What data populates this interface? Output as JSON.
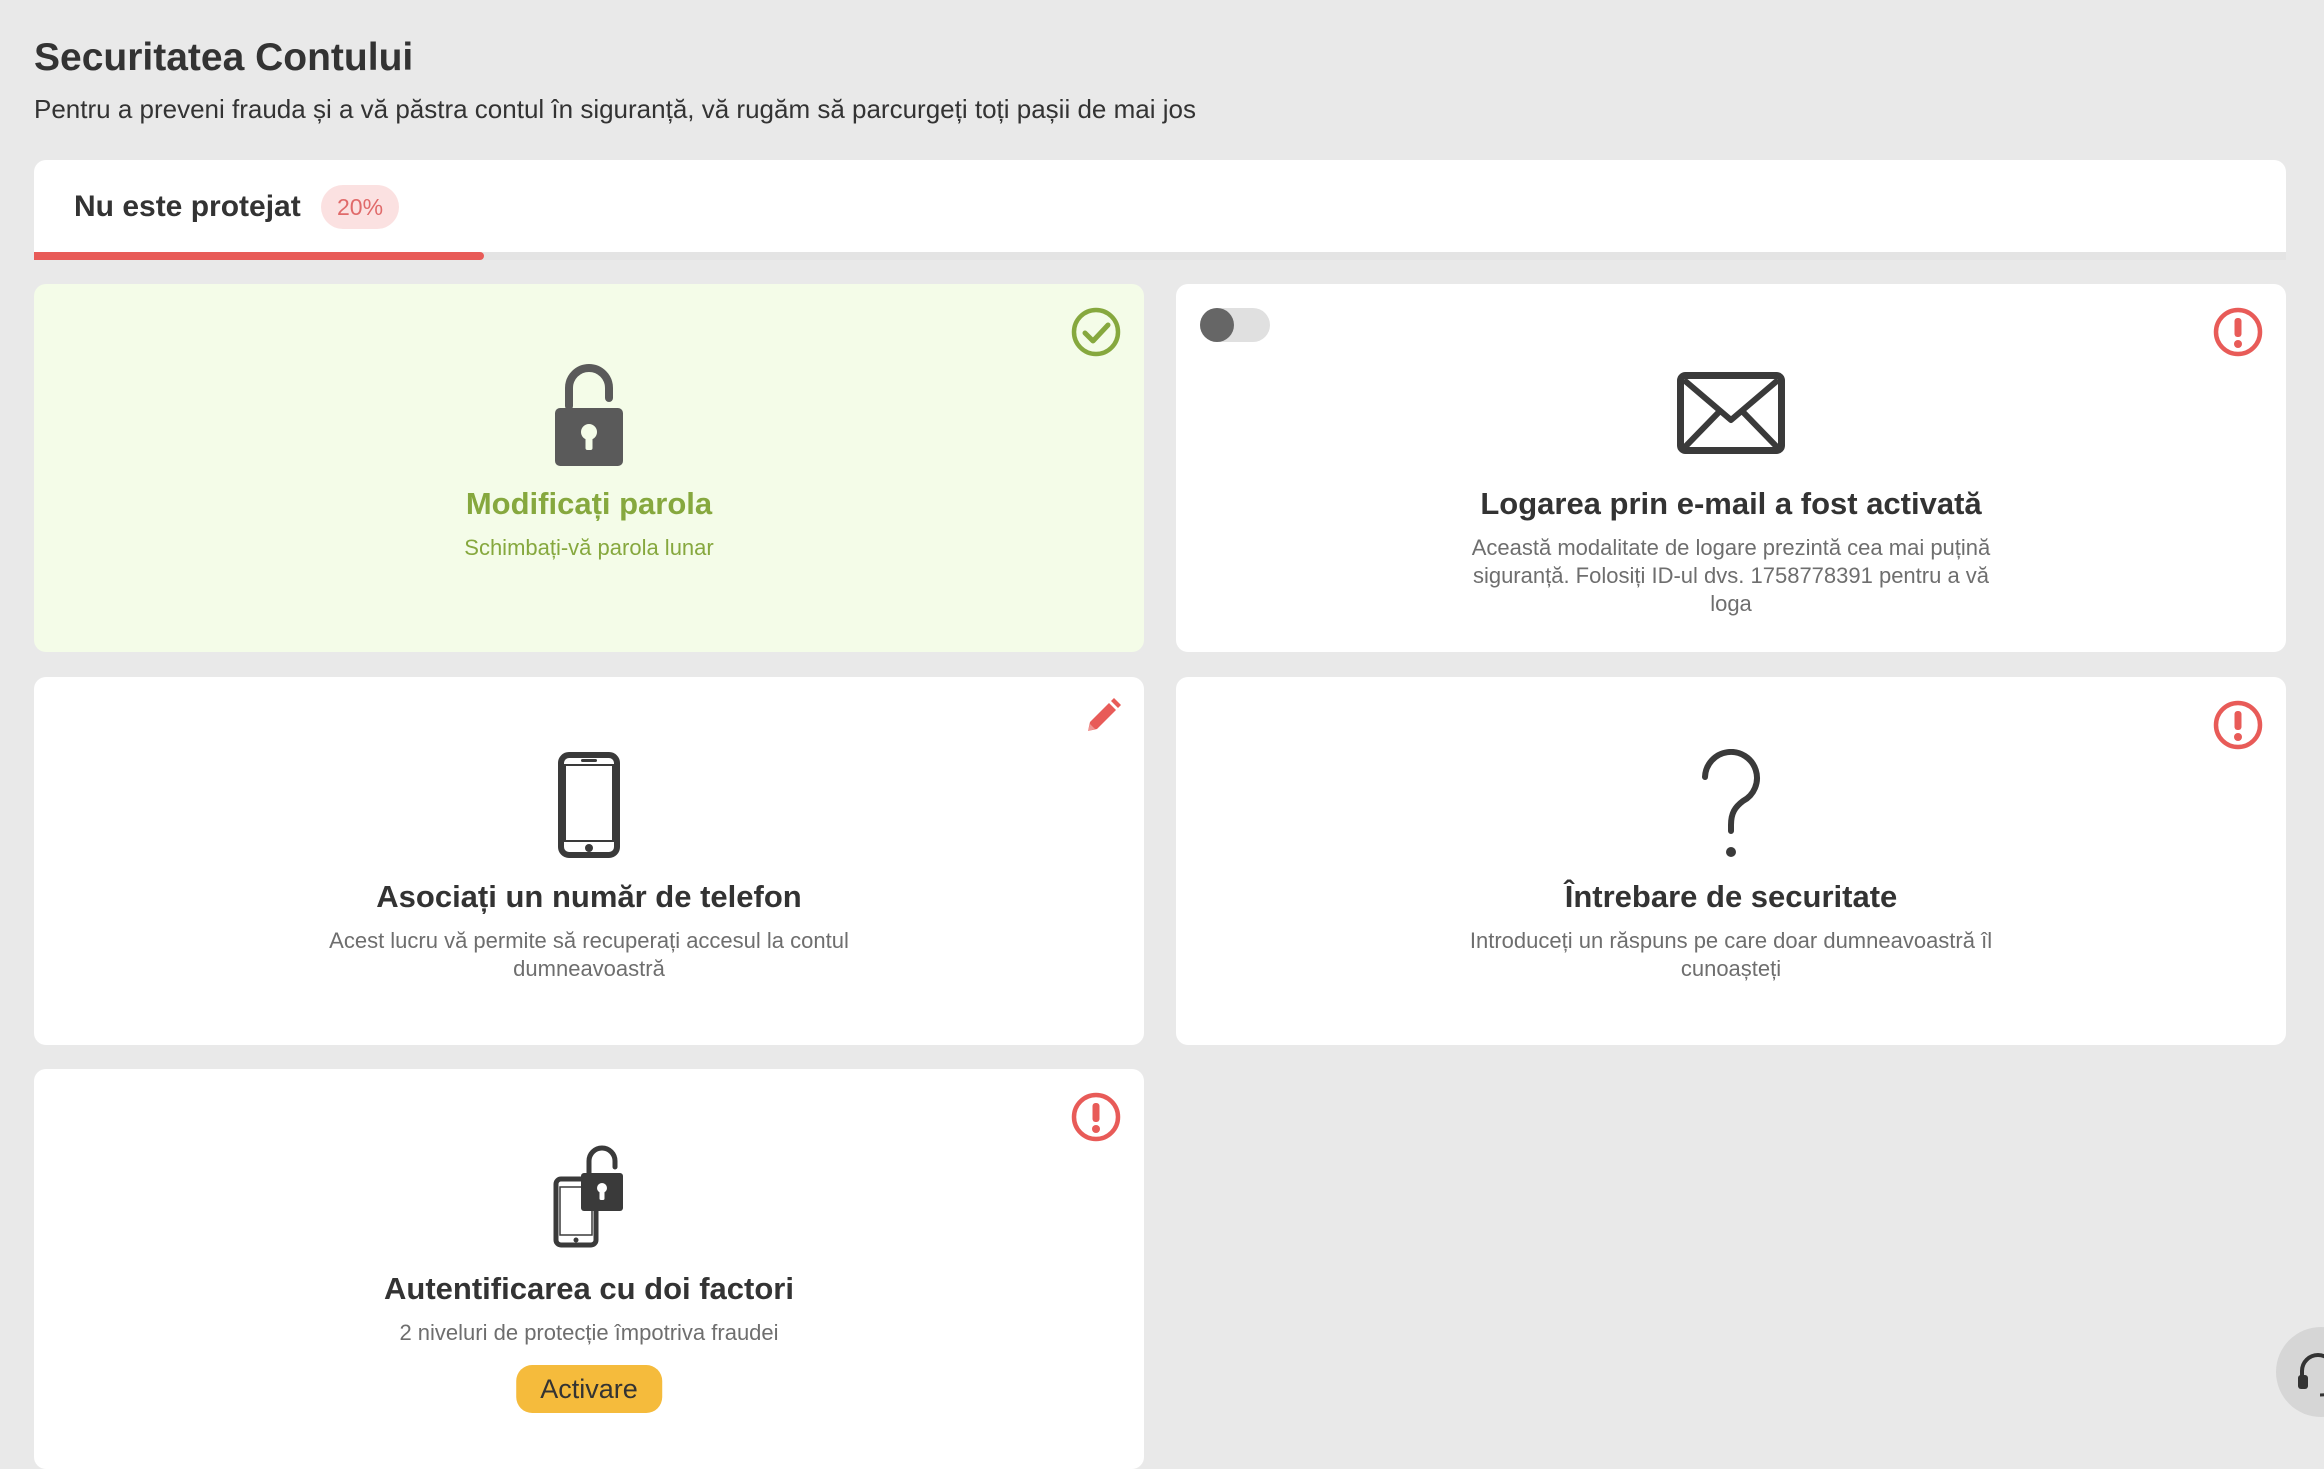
{
  "page": {
    "title": "Securitatea Contului",
    "subtitle": "Pentru a preveni frauda și a vă păstra contul în siguranță, vă rugăm să parcurgeți toți pașii de mai jos"
  },
  "protection": {
    "label": "Nu este protejat",
    "percent_label": "20%",
    "progress": 0.2
  },
  "cards": {
    "password": {
      "title": "Modificați parola",
      "description": "Schimbați-vă parola lunar",
      "status": "completed",
      "status_icon": "check-circle-icon",
      "icon": "padlock-open-icon"
    },
    "email_login": {
      "title": "Logarea prin e-mail a fost activată",
      "description": "Această modalitate de logare prezintă cea mai puțină siguranță. Folosiți ID-ul dvs. 1758778391 pentru a vă loga",
      "status": "warning",
      "status_icon": "alert-circle-icon",
      "icon": "envelope-icon",
      "toggle_on": false
    },
    "phone": {
      "title": "Asociați un număr de telefon",
      "description": "Acest lucru vă permite să recuperați accesul la contul dumneavoastră",
      "status": "edit",
      "status_icon": "pencil-icon",
      "icon": "smartphone-icon"
    },
    "security_question": {
      "title": "Întrebare de securitate",
      "description": "Introduceți un răspuns pe care doar dumneavoastră îl cunoașteți",
      "status": "warning",
      "status_icon": "alert-circle-icon",
      "icon": "question-mark-icon"
    },
    "two_factor": {
      "title": "Autentificarea cu doi factori",
      "description": "2 niveluri de protecție împotriva fraudei",
      "status": "warning",
      "status_icon": "alert-circle-icon",
      "icon": "phone-lock-icon",
      "button_label": "Activare"
    }
  },
  "support": {
    "icon": "headset-icon"
  },
  "colors": {
    "background": "#e9e9e9",
    "danger": "#e85b58",
    "success": "#86a83e",
    "success_bg": "#f4fce8",
    "badge_bg": "#fbe1e1",
    "accent_button": "#f5bb3c",
    "icon_dark": "#3a3a3a"
  }
}
